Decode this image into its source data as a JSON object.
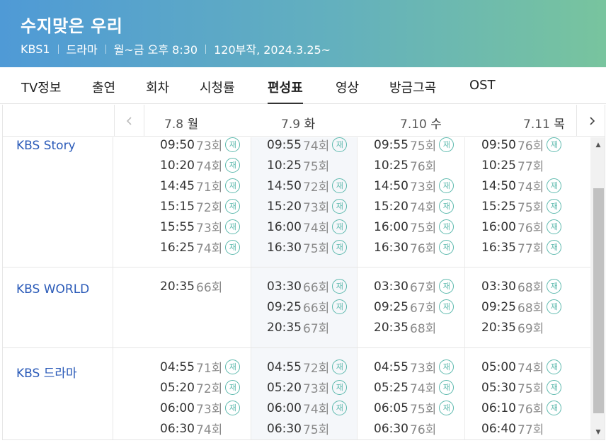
{
  "program": {
    "title": "수지맞은 우리",
    "channel": "KBS1",
    "genre": "드라마",
    "schedule": "월~금 오후 8:30",
    "episodes_dates": "120부작, 2024.3.25~"
  },
  "tabs": [
    "TV정보",
    "출연",
    "회차",
    "시청률",
    "편성표",
    "영상",
    "방금그곡",
    "OST"
  ],
  "active_tab": "편성표",
  "days": [
    {
      "date": "7.8",
      "dow": "월"
    },
    {
      "date": "7.9",
      "dow": "화"
    },
    {
      "date": "7.10",
      "dow": "수"
    },
    {
      "date": "7.11",
      "dow": "목"
    }
  ],
  "rerun_mark": "재",
  "colors": {
    "channel_link": "#2a5ab8",
    "rerun_badge": "#5cb9ad",
    "header_gradient_start": "#4f9ad6",
    "header_gradient_end": "#78c49e"
  },
  "icons": {
    "prev": "chevron-left-icon",
    "next": "chevron-right-icon",
    "rerun": "rerun-badge-icon"
  },
  "rows": [
    {
      "channel": "KBS Story",
      "days": [
        [
          {
            "time": "09:50",
            "ep": "73회",
            "rerun": true
          },
          {
            "time": "10:20",
            "ep": "74회",
            "rerun": true
          },
          {
            "time": "14:45",
            "ep": "71회",
            "rerun": true
          },
          {
            "time": "15:15",
            "ep": "72회",
            "rerun": true
          },
          {
            "time": "15:55",
            "ep": "73회",
            "rerun": true
          },
          {
            "time": "16:25",
            "ep": "74회",
            "rerun": true
          }
        ],
        [
          {
            "time": "09:55",
            "ep": "74회",
            "rerun": true
          },
          {
            "time": "10:25",
            "ep": "75회",
            "rerun": false
          },
          {
            "time": "14:50",
            "ep": "72회",
            "rerun": true
          },
          {
            "time": "15:20",
            "ep": "73회",
            "rerun": true
          },
          {
            "time": "16:00",
            "ep": "74회",
            "rerun": true
          },
          {
            "time": "16:30",
            "ep": "75회",
            "rerun": true
          }
        ],
        [
          {
            "time": "09:55",
            "ep": "75회",
            "rerun": true
          },
          {
            "time": "10:25",
            "ep": "76회",
            "rerun": false
          },
          {
            "time": "14:50",
            "ep": "73회",
            "rerun": true
          },
          {
            "time": "15:20",
            "ep": "74회",
            "rerun": true
          },
          {
            "time": "16:00",
            "ep": "75회",
            "rerun": true
          },
          {
            "time": "16:30",
            "ep": "76회",
            "rerun": true
          }
        ],
        [
          {
            "time": "09:50",
            "ep": "76회",
            "rerun": true
          },
          {
            "time": "10:25",
            "ep": "77회",
            "rerun": false
          },
          {
            "time": "14:50",
            "ep": "74회",
            "rerun": true
          },
          {
            "time": "15:25",
            "ep": "75회",
            "rerun": true
          },
          {
            "time": "16:00",
            "ep": "76회",
            "rerun": true
          },
          {
            "time": "16:35",
            "ep": "77회",
            "rerun": true
          }
        ]
      ]
    },
    {
      "channel": "KBS WORLD",
      "days": [
        [
          {
            "time": "20:35",
            "ep": "66회",
            "rerun": false
          }
        ],
        [
          {
            "time": "03:30",
            "ep": "66회",
            "rerun": true
          },
          {
            "time": "09:25",
            "ep": "66회",
            "rerun": true
          },
          {
            "time": "20:35",
            "ep": "67회",
            "rerun": false
          }
        ],
        [
          {
            "time": "03:30",
            "ep": "67회",
            "rerun": true
          },
          {
            "time": "09:25",
            "ep": "67회",
            "rerun": true
          },
          {
            "time": "20:35",
            "ep": "68회",
            "rerun": false
          }
        ],
        [
          {
            "time": "03:30",
            "ep": "68회",
            "rerun": true
          },
          {
            "time": "09:25",
            "ep": "68회",
            "rerun": true
          },
          {
            "time": "20:35",
            "ep": "69회",
            "rerun": false
          }
        ]
      ]
    },
    {
      "channel": "KBS 드라마",
      "days": [
        [
          {
            "time": "04:55",
            "ep": "71회",
            "rerun": true
          },
          {
            "time": "05:20",
            "ep": "72회",
            "rerun": true
          },
          {
            "time": "06:00",
            "ep": "73회",
            "rerun": true
          },
          {
            "time": "06:30",
            "ep": "74회",
            "rerun": false
          }
        ],
        [
          {
            "time": "04:55",
            "ep": "72회",
            "rerun": true
          },
          {
            "time": "05:20",
            "ep": "73회",
            "rerun": true
          },
          {
            "time": "06:00",
            "ep": "74회",
            "rerun": true
          },
          {
            "time": "06:30",
            "ep": "75회",
            "rerun": false
          }
        ],
        [
          {
            "time": "04:55",
            "ep": "73회",
            "rerun": true
          },
          {
            "time": "05:25",
            "ep": "74회",
            "rerun": true
          },
          {
            "time": "06:05",
            "ep": "75회",
            "rerun": true
          },
          {
            "time": "06:30",
            "ep": "76회",
            "rerun": false
          }
        ],
        [
          {
            "time": "05:00",
            "ep": "74회",
            "rerun": true
          },
          {
            "time": "05:30",
            "ep": "75회",
            "rerun": true
          },
          {
            "time": "06:10",
            "ep": "76회",
            "rerun": true
          },
          {
            "time": "06:40",
            "ep": "77회",
            "rerun": false
          }
        ]
      ]
    }
  ]
}
